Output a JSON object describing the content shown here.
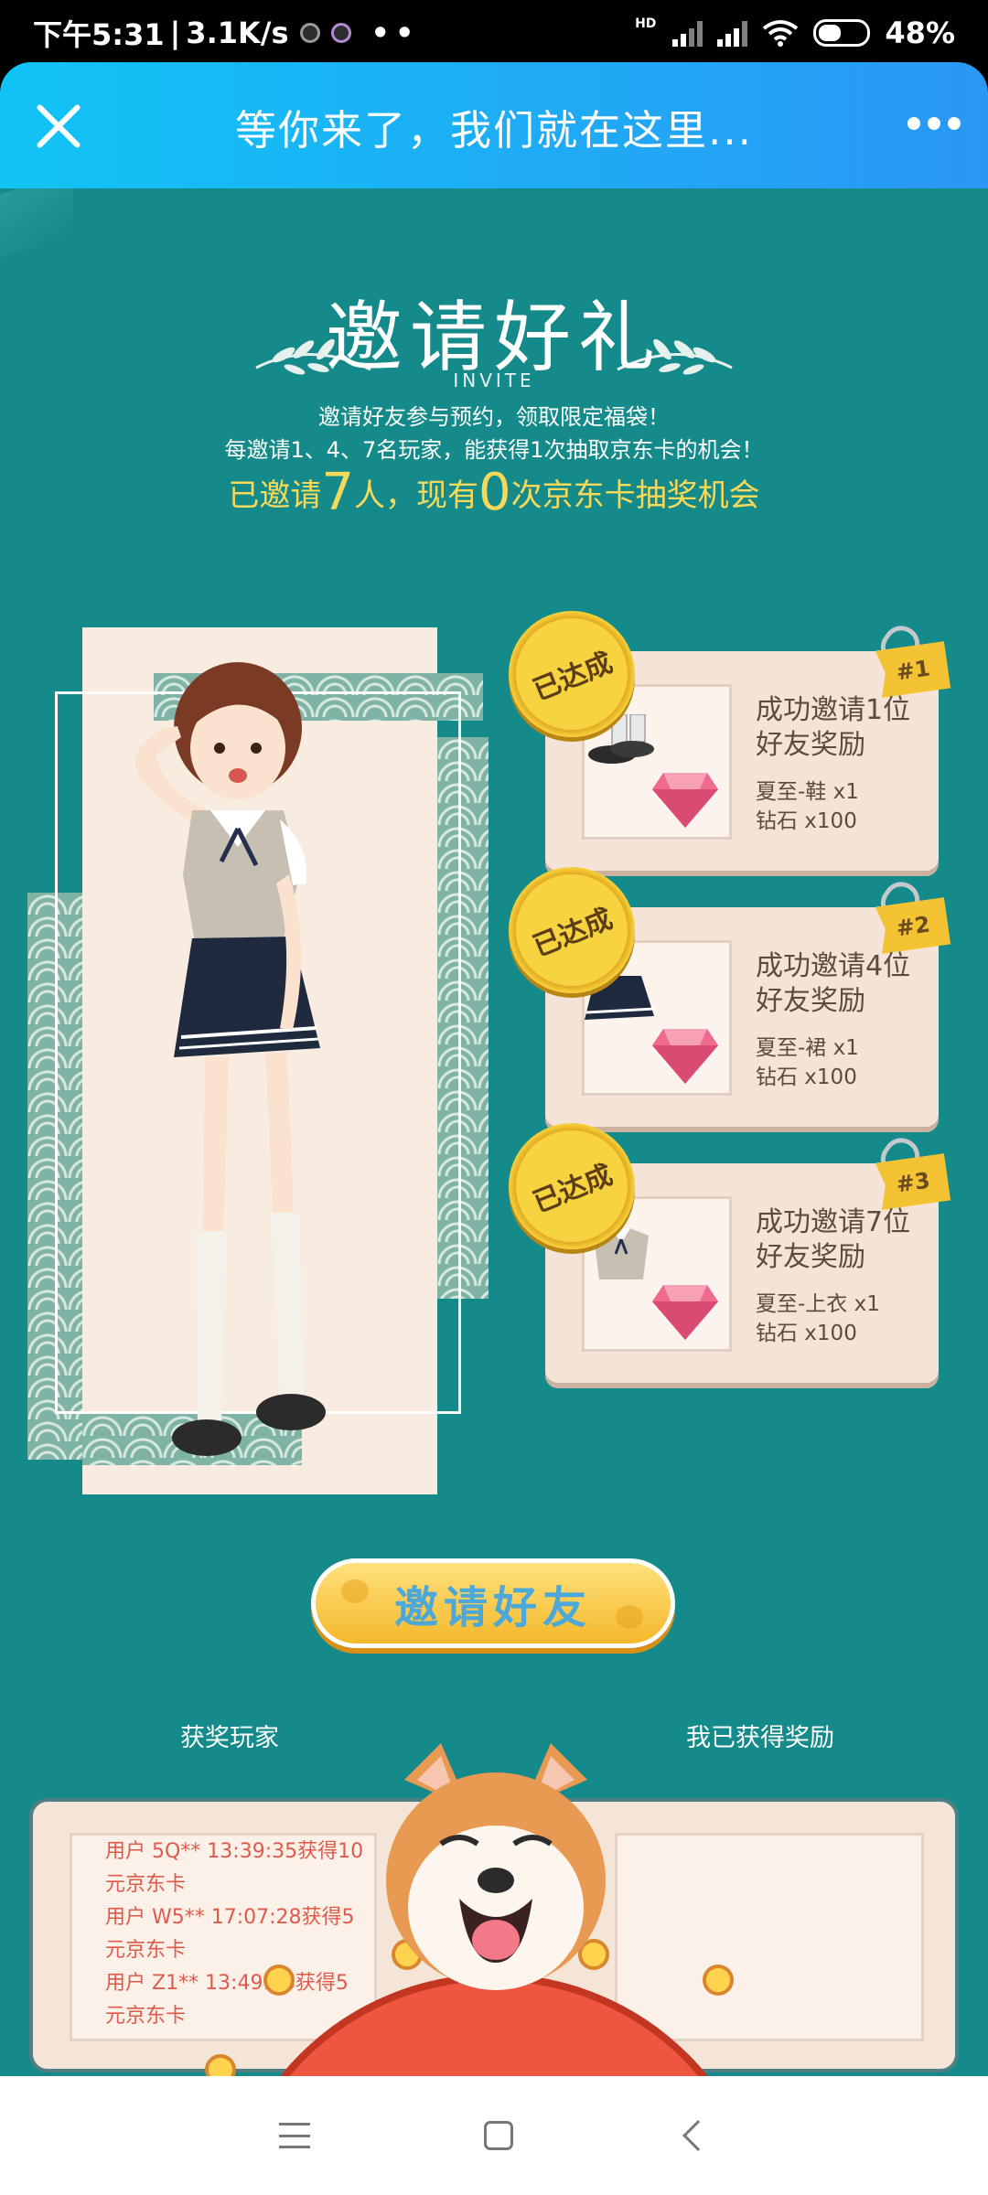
{
  "status_bar": {
    "time": "下午5:31",
    "separator": "|",
    "network_speed": "3.1K/s",
    "more_indicator": "••",
    "hd_label": "HD",
    "battery": "48%"
  },
  "title_bar": {
    "title": "等你来了，我们就在这里...",
    "close_icon": "close-icon",
    "more_icon": "more-icon"
  },
  "header": {
    "heading": "邀请好礼",
    "heading_en": "INVITE",
    "desc1": "邀请好友参与预约，领取限定福袋！",
    "desc2": "每邀请1、4、7名玩家，能获得1次抽取京东卡的机会！",
    "status_prefix": "已邀请",
    "invited_count": "7",
    "status_middle": "人，现有",
    "chances": "0",
    "status_suffix": "次京东卡抽奖机会"
  },
  "rewards": [
    {
      "badge": "已达成",
      "tag": "#1",
      "title": "成功邀请1位好友奖励",
      "item1": "夏至-鞋 x1",
      "item2": "钻石 x100"
    },
    {
      "badge": "已达成",
      "tag": "#2",
      "title": "成功邀请4位好友奖励",
      "item1": "夏至-裙 x1",
      "item2": "钻石 x100"
    },
    {
      "badge": "已达成",
      "tag": "#3",
      "title": "成功邀请7位好友奖励",
      "item1": "夏至-上衣 x1",
      "item2": "钻石 x100"
    }
  ],
  "invite_button": {
    "label": "邀请好友"
  },
  "bottom": {
    "winners_label": "获奖玩家",
    "mine_label": "我已获得奖励",
    "winners": [
      "用户 5Q** 13:39:35获得10元京东卡",
      "用户 W5** 17:07:28获得5元京东卡",
      "用户 Z1** 13:49:26获得5元京东卡"
    ]
  },
  "colors": {
    "page_bg": "#158a8a",
    "title_bar_start": "#11c4f5",
    "title_bar_end": "#2a97f5",
    "accent_yellow": "#f7d95a",
    "card_bg": "#f4e4d7",
    "winner_text": "#e05a4c"
  }
}
